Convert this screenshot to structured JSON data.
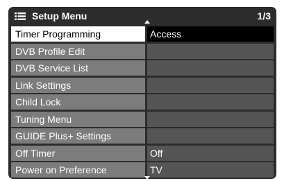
{
  "header": {
    "title": "Setup Menu",
    "icon": "menu-list-icon",
    "page": "1/3"
  },
  "colors": {
    "panel": "#2c2c2c",
    "label_bg": "#7c7c7c",
    "value_bg": "#555555",
    "selected_label_bg": "#ffffff",
    "selected_value_bg": "#000000",
    "text": "#ffffff"
  },
  "menu": {
    "selected_index": 0,
    "items": [
      {
        "label": "Timer Programming",
        "value": "Access"
      },
      {
        "label": "DVB Profile Edit",
        "value": ""
      },
      {
        "label": "DVB Service List",
        "value": ""
      },
      {
        "label": "Link Settings",
        "value": ""
      },
      {
        "label": "Child Lock",
        "value": ""
      },
      {
        "label": "Tuning Menu",
        "value": ""
      },
      {
        "label": "GUIDE Plus+ Settings",
        "value": ""
      },
      {
        "label": "Off Timer",
        "value": "Off"
      },
      {
        "label": "Power on Preference",
        "value": "TV"
      }
    ]
  }
}
